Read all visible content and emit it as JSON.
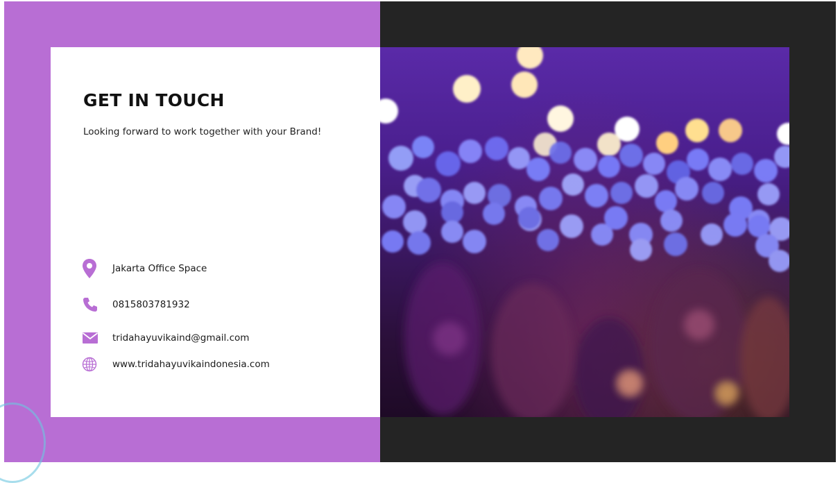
{
  "heading": "GET IN TOUCH",
  "tagline": "Looking forward to work together with your Brand!",
  "contacts": [
    {
      "icon": "location-pin-icon",
      "text": "Jakarta Office Space"
    },
    {
      "icon": "phone-icon",
      "text": "0815803781932"
    },
    {
      "icon": "email-icon",
      "text": "tridahayuvikaind@gmail.com"
    },
    {
      "icon": "globe-icon",
      "text": "www.tridahayuvikaindonesia.com"
    }
  ],
  "colors": {
    "accent": "#b86ed4",
    "dark_panel": "#242424",
    "card": "#ffffff"
  }
}
